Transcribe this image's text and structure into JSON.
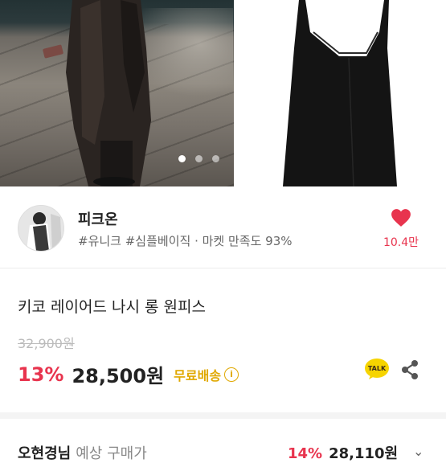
{
  "gallery": {
    "page_dots": [
      true,
      false,
      false
    ]
  },
  "seller": {
    "name": "피크온",
    "tags": "#유니크 #심플베이직 · 마켓 만족도 93%",
    "like_count": "10.4만"
  },
  "product": {
    "title": "키코 레이어드 나시 롱 원피스",
    "original_price": "32,900원",
    "discount_rate": "13%",
    "sale_price": "28,500원",
    "shipping": "무료배송",
    "talk_badge": "TALK"
  },
  "coupon": {
    "label": "오현경님",
    "sub": "예상 구매가",
    "discount_rate": "14%",
    "price": "28,110원"
  },
  "colors": {
    "accent_red": "#e8344e",
    "shipping_yellow": "#e0a800",
    "talk_yellow": "#f6d400"
  }
}
